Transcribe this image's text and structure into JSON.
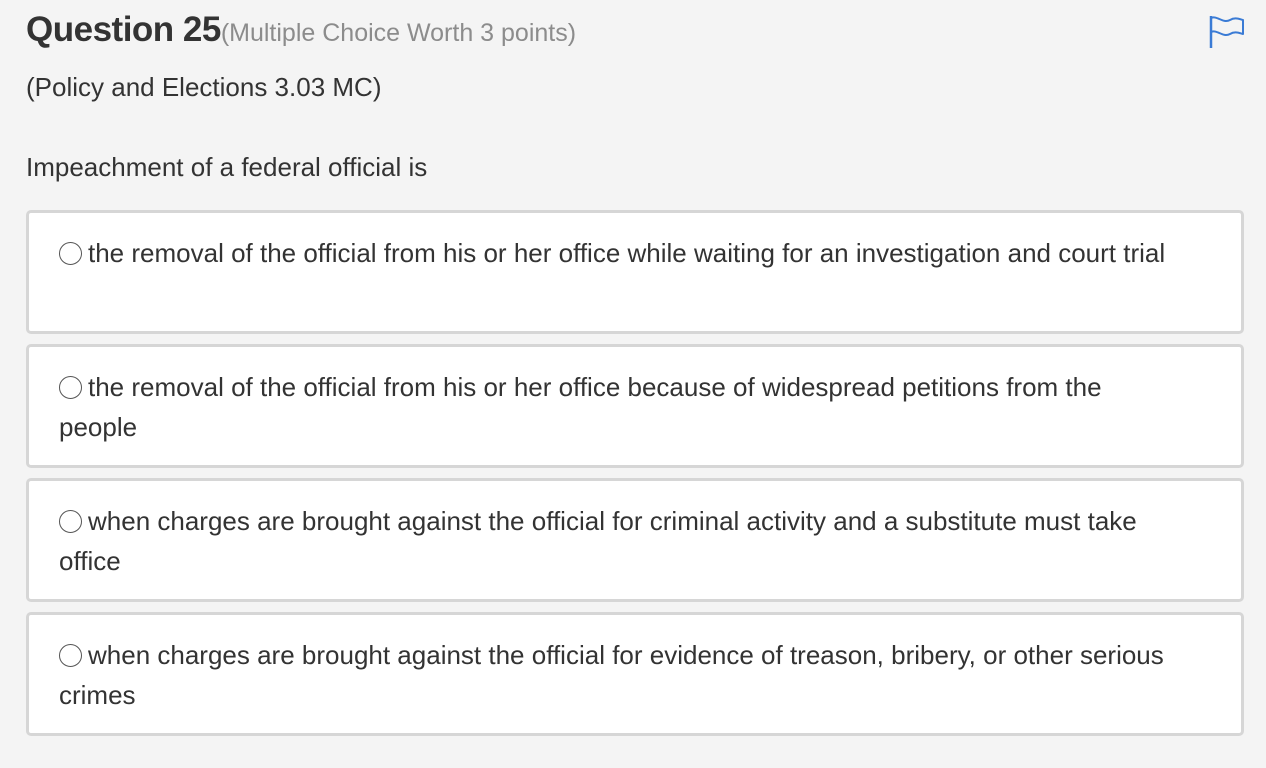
{
  "question": {
    "title": "Question 25",
    "meta": "(Multiple Choice Worth 3 points)",
    "category": "(Policy and Elections 3.03 MC)",
    "prompt": "Impeachment of a federal official is"
  },
  "icons": {
    "flag": "flag-icon",
    "radio": "radio-button"
  },
  "colors": {
    "flag": "#3a7bd5",
    "choice_border": "#d6d6d6",
    "background": "#f4f4f4"
  },
  "choices": [
    {
      "label": "the removal of the official from his or her office while waiting for an investigation and court trial"
    },
    {
      "label": "the removal of the official from his or her office because of widespread petitions from the people"
    },
    {
      "label": "when charges are brought against the official for criminal activity and a substitute must take office"
    },
    {
      "label": "when charges are brought against the official for evidence of treason, bribery, or other serious crimes"
    }
  ]
}
